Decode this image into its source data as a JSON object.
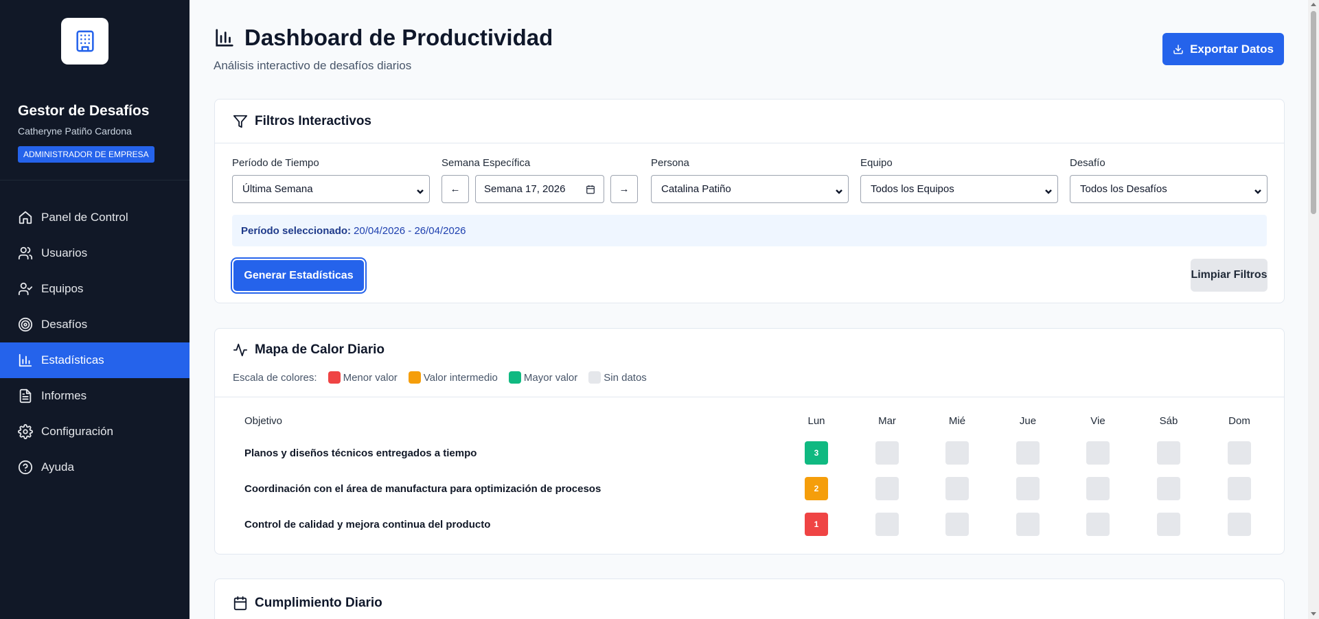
{
  "sidebar": {
    "brand_title": "Gestor de Desafíos",
    "user_name": "Catheryne Patiño Cardona",
    "role": "ADMINISTRADOR DE EMPRESA",
    "items": [
      {
        "label": "Panel de Control",
        "icon": "home-icon"
      },
      {
        "label": "Usuarios",
        "icon": "users-icon"
      },
      {
        "label": "Equipos",
        "icon": "user-check-icon"
      },
      {
        "label": "Desafíos",
        "icon": "target-icon"
      },
      {
        "label": "Estadísticas",
        "icon": "bar-chart-icon",
        "active": true
      },
      {
        "label": "Informes",
        "icon": "file-text-icon"
      },
      {
        "label": "Configuración",
        "icon": "gear-icon"
      },
      {
        "label": "Ayuda",
        "icon": "help-circle-icon"
      }
    ]
  },
  "header": {
    "title": "Dashboard de Productividad",
    "subtitle": "Análisis interactivo de desafíos diarios",
    "export_label": "Exportar Datos"
  },
  "filters": {
    "title": "Filtros Interactivos",
    "period_label": "Período de Tiempo",
    "period_value": "Última Semana",
    "week_label": "Semana Específica",
    "week_prev": "←",
    "week_value": "Semana 17, 2026",
    "week_next": "→",
    "person_label": "Persona",
    "person_value": "Catalina Patiño",
    "team_label": "Equipo",
    "team_value": "Todos los Equipos",
    "challenge_label": "Desafío",
    "challenge_value": "Todos los Desafíos",
    "selected_period_label": "Período seleccionado:",
    "selected_period_value": "20/04/2026 - 26/04/2026",
    "generate_label": "Generar Estadísticas",
    "clear_label": "Limpiar Filtros"
  },
  "heatmap": {
    "title": "Mapa de Calor Diario",
    "legend_prefix": "Escala de colores:",
    "legend": [
      {
        "label": "Menor valor",
        "color": "#ef4444"
      },
      {
        "label": "Valor intermedio",
        "color": "#f59e0b"
      },
      {
        "label": "Mayor valor",
        "color": "#10b981"
      },
      {
        "label": "Sin datos",
        "color": "#e5e7eb"
      }
    ],
    "objective_header": "Objetivo",
    "days": [
      "Lun",
      "Mar",
      "Mié",
      "Jue",
      "Vie",
      "Sáb",
      "Dom"
    ],
    "rows": [
      {
        "label": "Planos y diseños técnicos entregados a tiempo",
        "values": [
          "3",
          "",
          "",
          "",
          "",
          "",
          ""
        ],
        "color": "#10b981"
      },
      {
        "label": "Coordinación con el área de manufactura para optimización de procesos",
        "values": [
          "2",
          "",
          "",
          "",
          "",
          "",
          ""
        ],
        "color": "#f59e0b"
      },
      {
        "label": "Control de calidad y mejora continua del producto",
        "values": [
          "1",
          "",
          "",
          "",
          "",
          "",
          ""
        ],
        "color": "#ef4444"
      }
    ]
  },
  "daily": {
    "title": "Cumplimiento Diario"
  }
}
